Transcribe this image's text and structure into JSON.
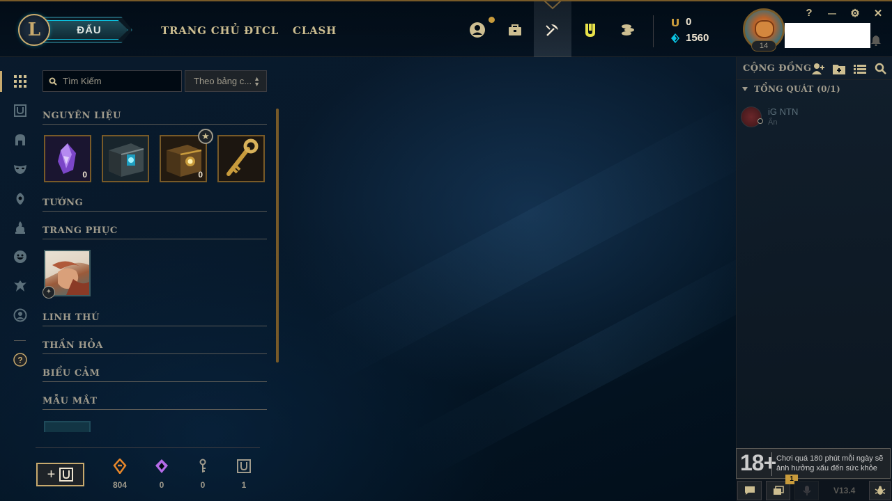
{
  "header": {
    "play_label": "ĐẤU",
    "nav": [
      "TRANG CHỦ",
      "ĐTCL",
      "CLASH"
    ],
    "rp": "0",
    "be": "1560",
    "level": "14",
    "window": {
      "help": "?",
      "minimize": "—",
      "settings": "⚙",
      "close": "✕"
    }
  },
  "loot": {
    "search_placeholder": "Tìm Kiếm",
    "sort_label": "Theo bảng c...",
    "sections": {
      "materials": "NGUYÊN LIỆU",
      "champions": "TƯỚNG",
      "skins": "TRANG PHỤC",
      "companions": "LINH THÚ",
      "totems": "THẦN HỎA",
      "emotes": "BIỂU CẢM",
      "ward_skins": "MẪU MẮT"
    },
    "material_counts": [
      "0",
      "0"
    ],
    "star_glyph": "★",
    "craft_label": "+",
    "currencies": [
      {
        "icon": "orange-essence-icon",
        "value": "804",
        "color": "#e8872a"
      },
      {
        "icon": "mythic-essence-icon",
        "value": "0",
        "color": "#b56be8"
      },
      {
        "icon": "key-fragment-icon",
        "value": "0",
        "color": "#a09b8c"
      },
      {
        "icon": "chest-icon",
        "value": "1",
        "color": "#a09b8c"
      }
    ]
  },
  "social": {
    "title": "CỘNG ĐỒNG",
    "group": "TỔNG QUÁT (0/1)",
    "friend_name": "iG NTN",
    "friend_status": "Ẩn",
    "age_rating": "18+",
    "age_warning": "Chơi quá 180 phút mỗi ngày sẽ ảnh hưởng xấu đến sức khỏe",
    "notification_count": "1",
    "version": "V13.4"
  },
  "colors": {
    "gold": "#c8aa6e",
    "gold_dark": "#785a28",
    "text": "#cdbe91",
    "muted": "#a09b8c",
    "rp_gold": "#c89b3c",
    "be_blue": "#0bc4e3"
  }
}
